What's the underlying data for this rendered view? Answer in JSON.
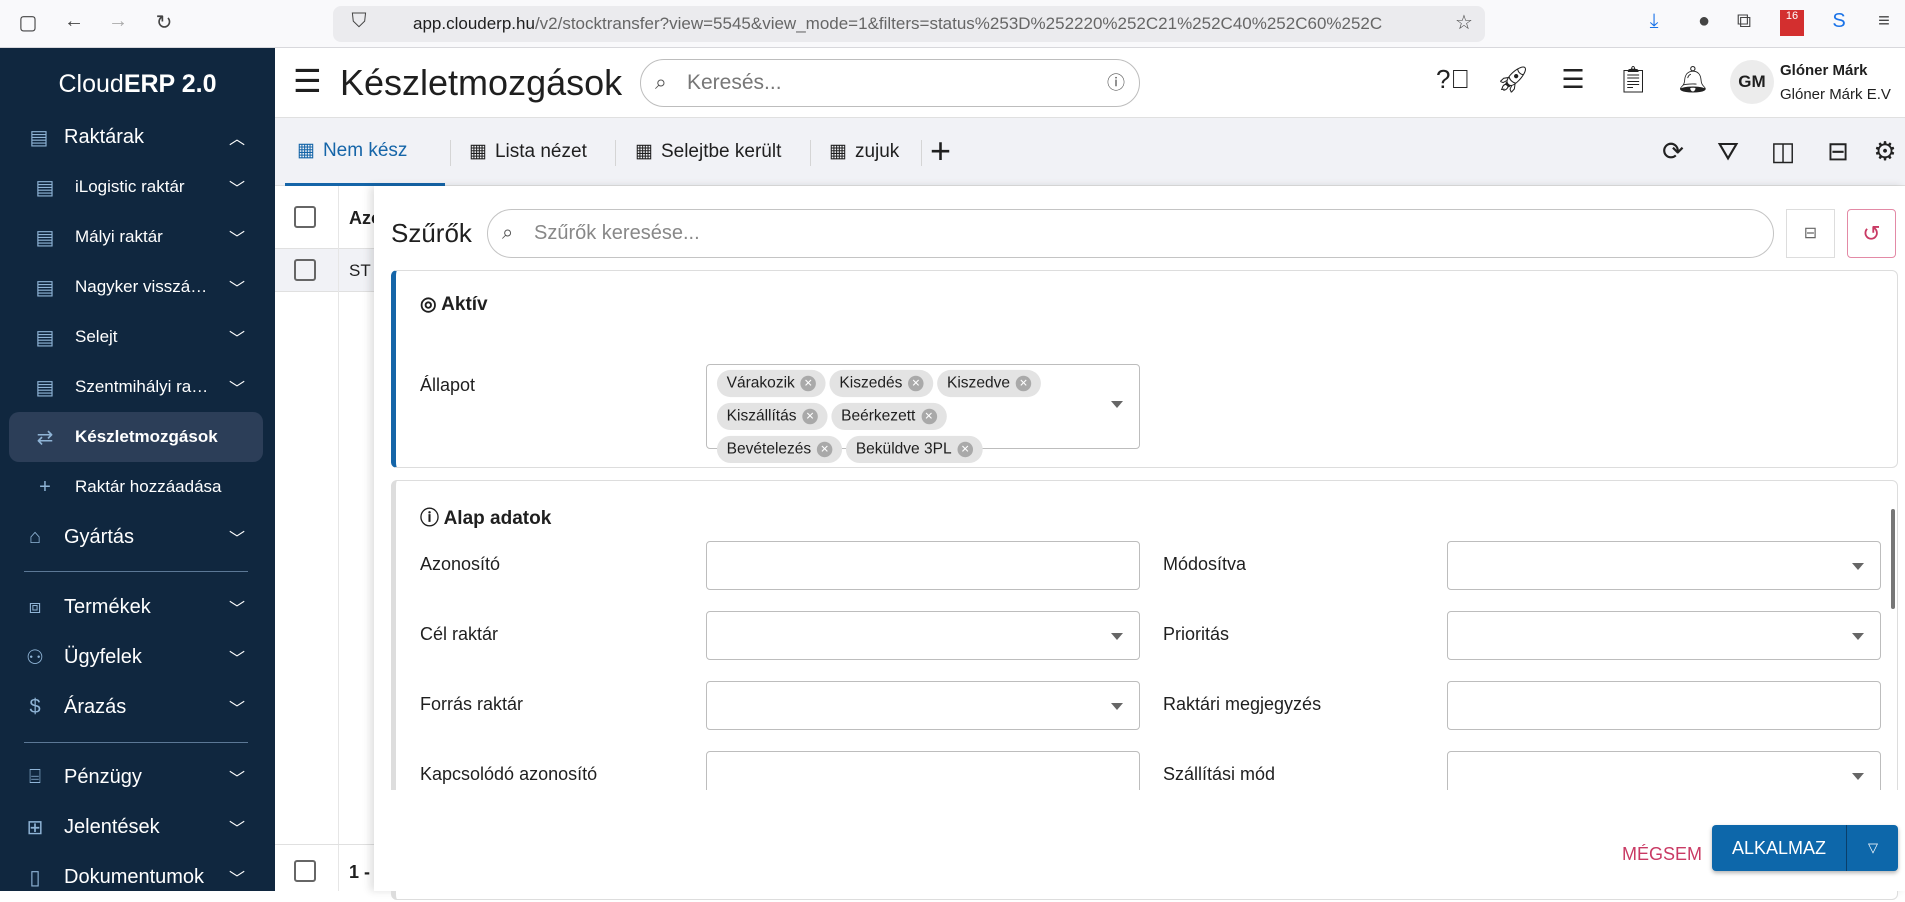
{
  "browser": {
    "url_domain": "app.clouderp.hu",
    "url_path": "/v2/stocktransfer?view=5545&view_mode=1&filters=status%253D%252220%252C21%252C40%252C60%252C",
    "ext_badge": "16"
  },
  "sidebar": {
    "logo_plain": "Cloud",
    "logo_bold": "ERP 2.0",
    "items": [
      {
        "label": "Raktárak",
        "icon": "warehouse-icon"
      },
      {
        "label": "iLogistic raktár"
      },
      {
        "label": "Mályi raktár"
      },
      {
        "label": "Nagyker visszá…"
      },
      {
        "label": "Selejt"
      },
      {
        "label": "Szentmihályi ra…"
      },
      {
        "label": "Készletmozgások"
      },
      {
        "label": "Raktár hozzáadása"
      },
      {
        "label": "Gyártás"
      },
      {
        "label": "Termékek"
      },
      {
        "label": "Ügyfelek"
      },
      {
        "label": "Árazás"
      },
      {
        "label": "Pénzügy"
      },
      {
        "label": "Jelentések"
      },
      {
        "label": "Dokumentumok"
      }
    ]
  },
  "header": {
    "title": "Készletmozgások",
    "search_placeholder": "Keresés...",
    "user_initials": "GM",
    "user_name": "Glóner Márk",
    "user_company": "Glóner Márk E.V"
  },
  "tabs": [
    {
      "label": "Nem kész"
    },
    {
      "label": "Lista nézet"
    },
    {
      "label": "Selejtbe került"
    },
    {
      "label": "zujuk"
    }
  ],
  "table": {
    "header_col": "Azo",
    "row_value": "ST",
    "footer": "1 -"
  },
  "filters": {
    "title": "Szűrők",
    "search_placeholder": "Szűrők keresése...",
    "active": {
      "title": "Aktív",
      "field_label": "Állapot",
      "chips": [
        "Várakozik",
        "Kiszedés",
        "Kiszedve",
        "Kiszállítás",
        "Beérkezett",
        "Bevételezés",
        "Beküldve 3PL"
      ]
    },
    "basic": {
      "title": "Alap adatok",
      "fields": [
        {
          "left": "Azonosító",
          "right": "Módosítva"
        },
        {
          "left": "Cél raktár",
          "right": "Prioritás"
        },
        {
          "left": "Forrás raktár",
          "right": "Raktári megjegyzés"
        },
        {
          "left": "Kapcsolódó azonosító",
          "right": "Szállítási mód"
        }
      ]
    },
    "cancel_label": "MÉGSEM",
    "apply_label": "ALKALMAZ"
  },
  "colors": {
    "sidebar": "#10273f",
    "accent": "#1565a8",
    "danger": "#c93a64"
  }
}
